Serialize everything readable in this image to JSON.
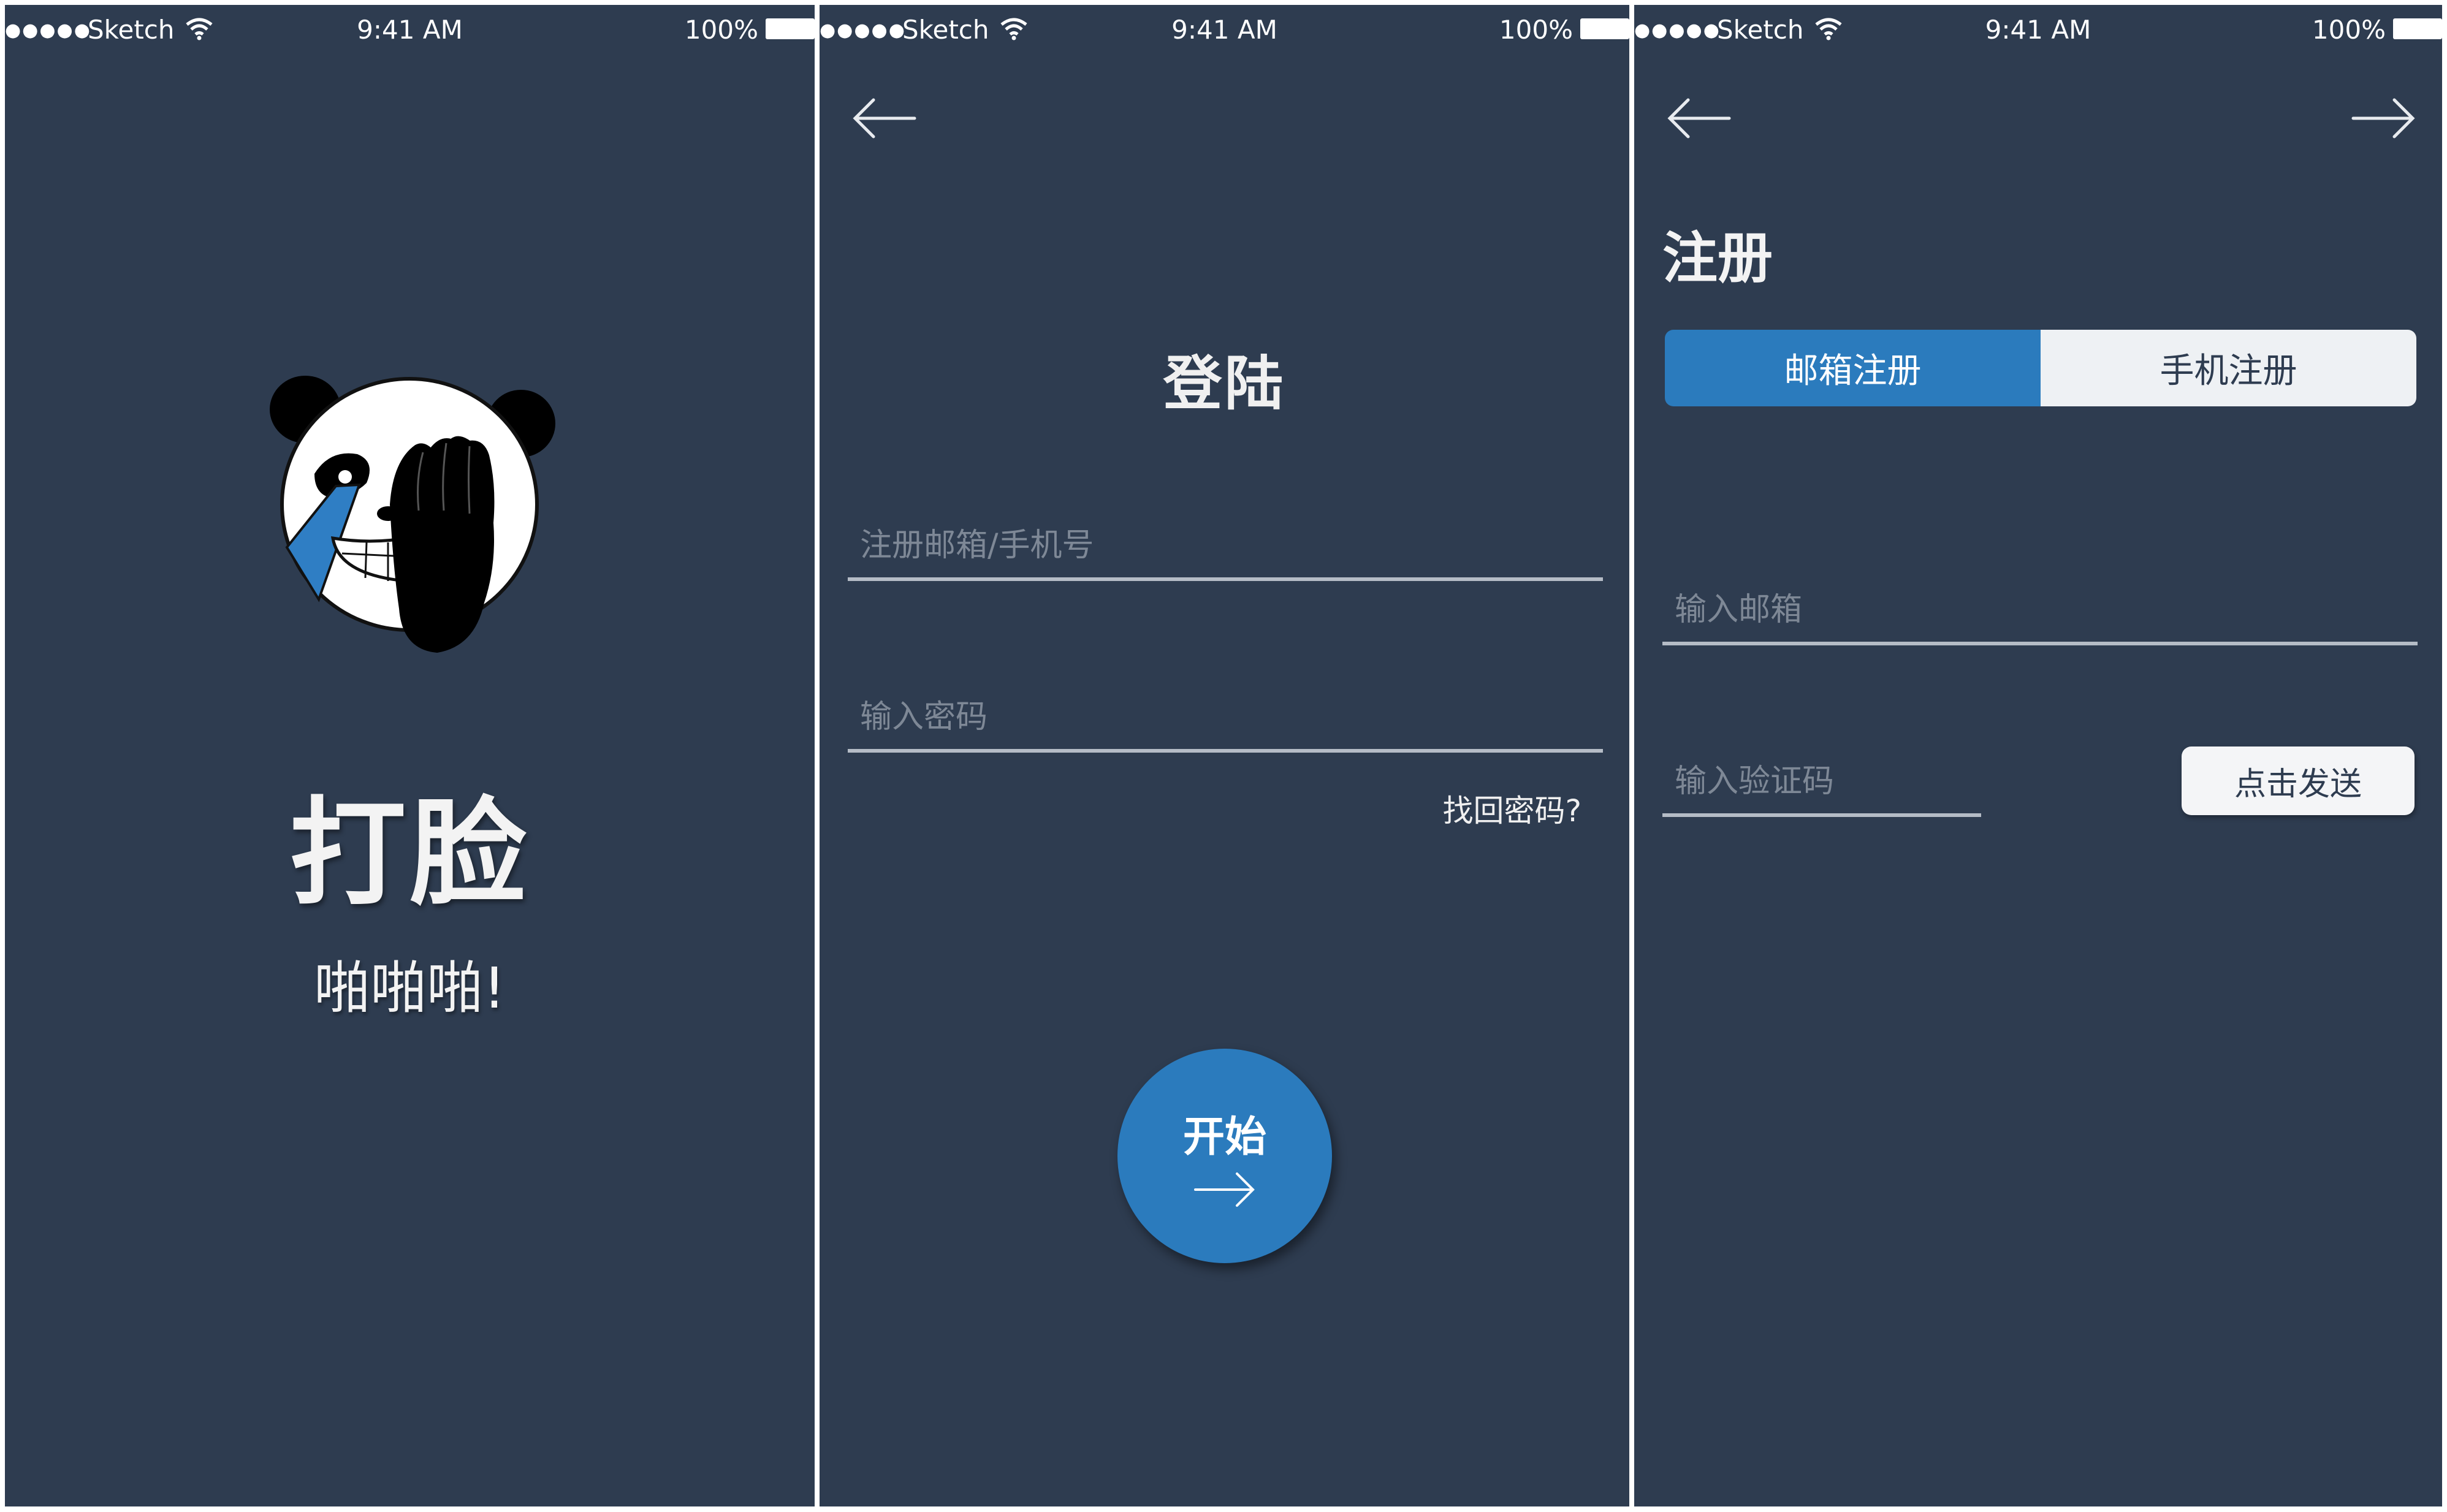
{
  "status_bar": {
    "signal": "●●●●●",
    "carrier": "Sketch",
    "time": "9:41 AM",
    "battery": "100%"
  },
  "splash": {
    "title": "打脸",
    "tagline": "啪啪啪!",
    "logo_icon": "panda-facepalm-icon"
  },
  "login": {
    "title": "登陆",
    "account_placeholder": "注册邮箱/手机号",
    "password_placeholder": "输入密码",
    "forgot_password": "找回密码?",
    "start_button": "开始"
  },
  "register": {
    "title": "注册",
    "tabs": [
      {
        "label": "邮箱注册",
        "selected": true
      },
      {
        "label": "手机注册",
        "selected": false
      }
    ],
    "email_placeholder": "输入邮箱",
    "code_placeholder": "输入验证码",
    "send_code_button": "点击发送"
  },
  "colors": {
    "background": "#2e3c50",
    "accent": "#2b7bbd",
    "underline": "#b5bcc6"
  }
}
